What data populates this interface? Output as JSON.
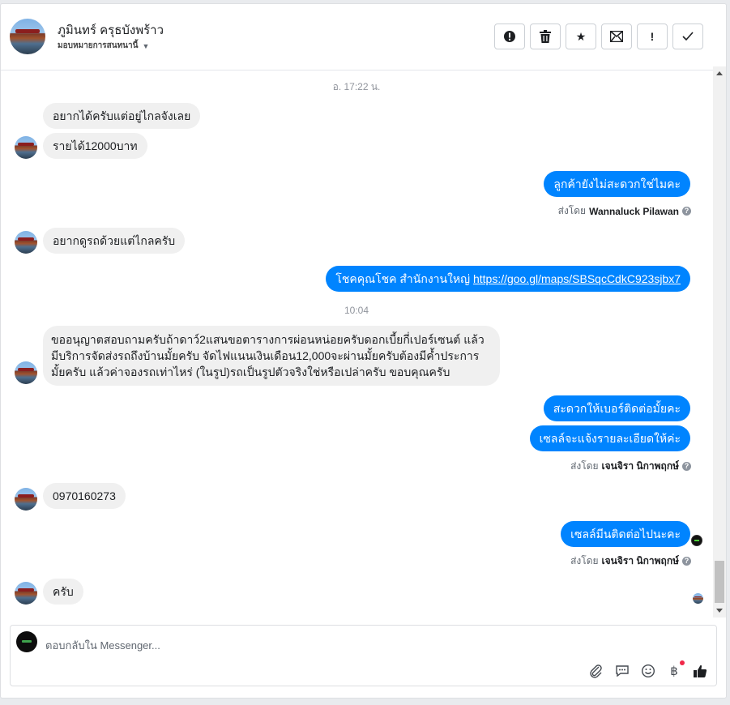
{
  "header": {
    "contact_name": "ภูมินทร์ ครุธบังพร้าว",
    "assign_label": "มอบหมายการสนทนานี้",
    "actions": [
      {
        "name": "spam-button",
        "icon": "!"
      },
      {
        "name": "delete-button",
        "icon": "trash"
      },
      {
        "name": "star-button",
        "icon": "★"
      },
      {
        "name": "mark-unread-button",
        "icon": "envelope"
      },
      {
        "name": "follow-up-button",
        "icon": "!"
      },
      {
        "name": "done-button",
        "icon": "✓"
      }
    ]
  },
  "chat": {
    "time1": "อ. 17:22 น.",
    "msg1": "อยากได้ครับแต่อยู่ไกลจังเลย",
    "msg2": "รายได้12000บาท",
    "msg3": "ลูกค้ายังไม่สะดวกใช่ไมคะ",
    "sent_by_prefix": "ส่งโดย",
    "sender1": "Wannaluck Pilawan",
    "msg4": "อยากดูรถด้วยแต่ไกลครับ",
    "msg5_text": "โชคคุณโชค สำนักงานใหญ่ ",
    "msg5_link": "https://goo.gl/maps/SBSqcCdkC923sjbx7",
    "time2": "10:04",
    "msg6": "ขออนุญาตสอบถามครับถ้าดาว์2แสนขอตารางการผ่อนหน่อยครับดอกเบี้ยกี่เปอร์เซนต์ แล้วมีบริการจัดส่งรถถึงบ้านมั้ยครับ จัดไฟแนนเงินเดือน12,000จะผ่านมั้ยครับต้องมีค้ำประการมั้ยครับ แล้วค่าจองรถเท่าไหร่ (ในรูป)รถเป็นรูปตัวจริงใช่หรือเปล่าครับ ขอบคุณครับ",
    "msg7": "สะดวกให้เบอร์ติดต่อมั้ยคะ",
    "msg8": "เซลล์จะแจ้งรายละเอียดให้ค่ะ",
    "sender2": "เจนจิรา นิกาพฤกษ์",
    "msg9": "0970160273",
    "msg10": "เซลล์มีนติดต่อไปนะคะ",
    "sender3": "เจนจิรา นิกาพฤกษ์",
    "msg11": "ครับ"
  },
  "composer": {
    "placeholder": "ตอบกลับใน Messenger..."
  },
  "colors": {
    "outgoing": "#0084ff",
    "incoming": "#f0f0f0",
    "notification": "#f02849"
  }
}
